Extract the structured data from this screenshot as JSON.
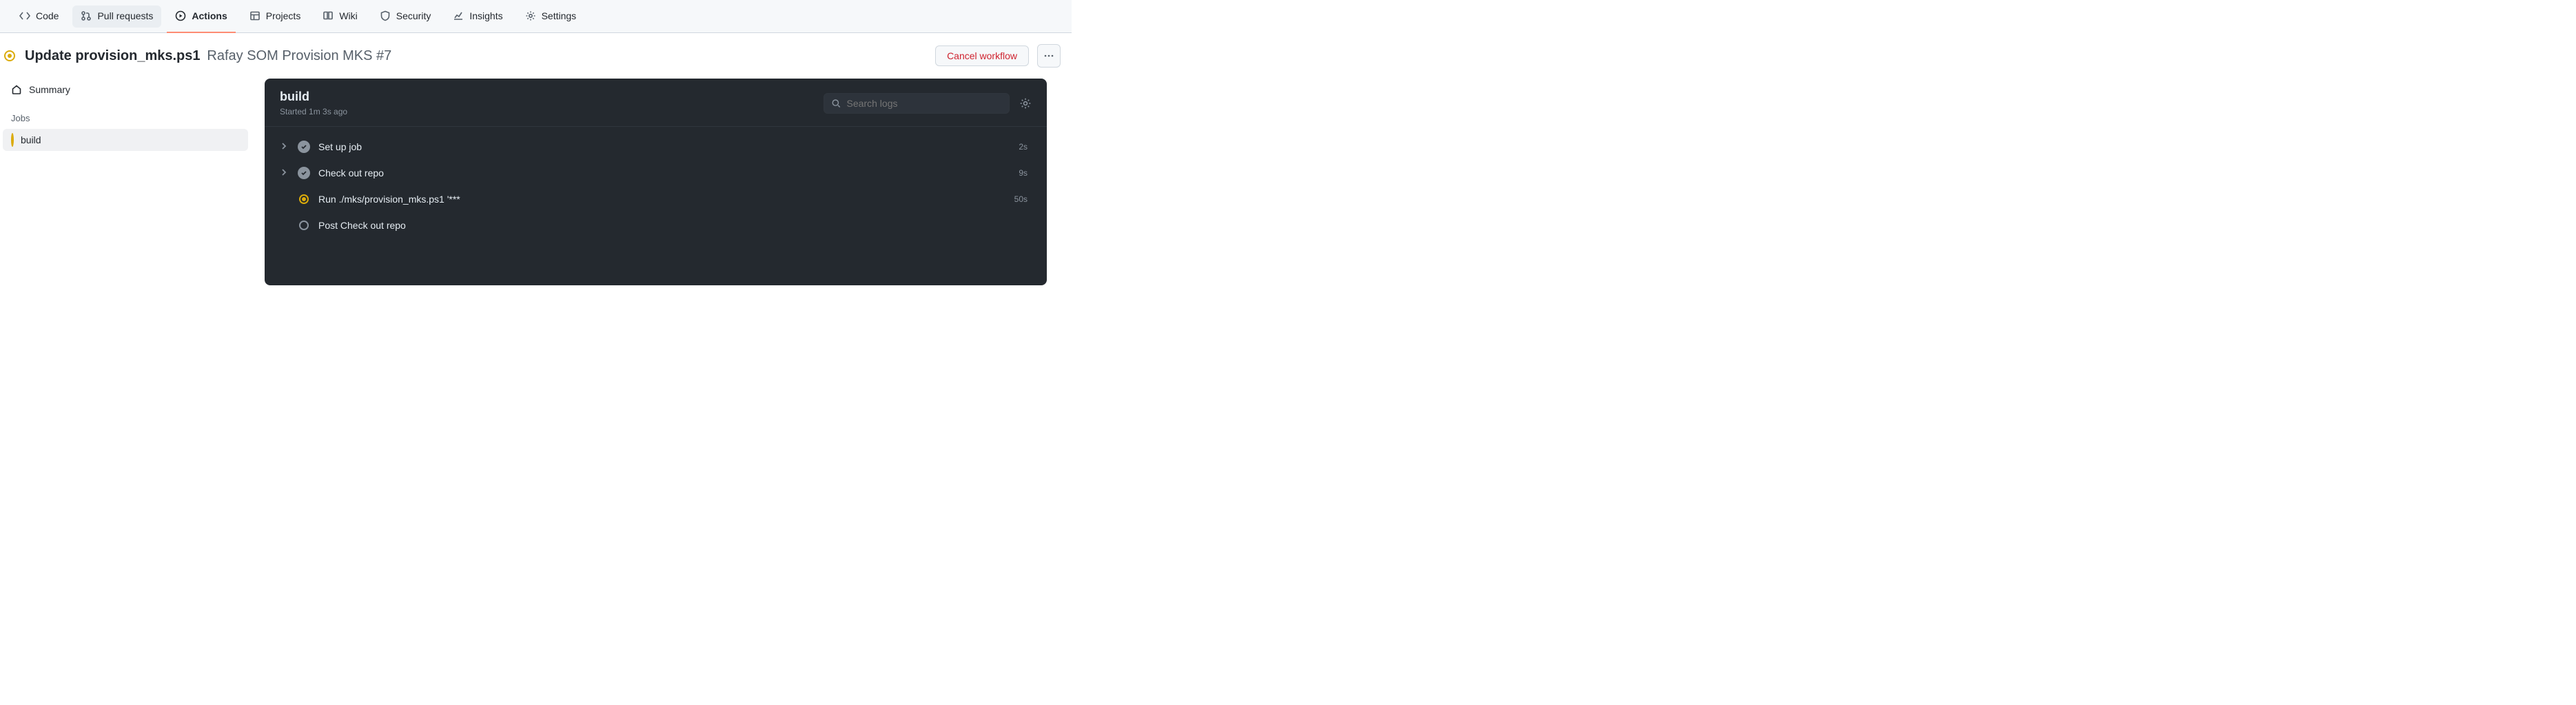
{
  "nav": {
    "code": "Code",
    "pull_requests": "Pull requests",
    "actions": "Actions",
    "projects": "Projects",
    "wiki": "Wiki",
    "security": "Security",
    "insights": "Insights",
    "settings": "Settings"
  },
  "run": {
    "title": "Update provision_mks.ps1",
    "workflow_and_num": "Rafay SOM Provision MKS #7",
    "cancel_label": "Cancel workflow"
  },
  "sidebar": {
    "summary": "Summary",
    "jobs_label": "Jobs",
    "job_name": "build"
  },
  "panel": {
    "job_name": "build",
    "started": "Started 1m 3s ago",
    "search_placeholder": "Search logs"
  },
  "steps": [
    {
      "label": "Set up job",
      "status": "success",
      "collapsible": true,
      "duration": "2s"
    },
    {
      "label": "Check out repo",
      "status": "success",
      "collapsible": true,
      "duration": "9s"
    },
    {
      "label": "Run ./mks/provision_mks.ps1 '***",
      "status": "inprogress",
      "collapsible": false,
      "duration": "50s"
    },
    {
      "label": "Post Check out repo",
      "status": "pending",
      "collapsible": false,
      "duration": ""
    }
  ],
  "colors": {
    "accent_orange": "#fd8c73",
    "amber": "#dbab0a",
    "danger": "#cf222e",
    "panel_bg": "#24292f"
  }
}
